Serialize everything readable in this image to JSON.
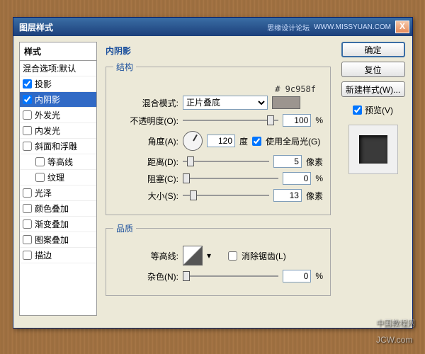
{
  "titlebar": {
    "title": "图层样式",
    "brand": "思缘设计论坛",
    "site": "WWW.MISSYUAN.COM",
    "close": "X"
  },
  "left": {
    "header": "样式",
    "blend_default": "混合选项:默认",
    "items": [
      {
        "label": "投影",
        "checked": true,
        "selected": false
      },
      {
        "label": "内阴影",
        "checked": true,
        "selected": true
      },
      {
        "label": "外发光",
        "checked": false,
        "selected": false
      },
      {
        "label": "内发光",
        "checked": false,
        "selected": false
      },
      {
        "label": "斜面和浮雕",
        "checked": false,
        "selected": false
      },
      {
        "label": "等高线",
        "checked": false,
        "selected": false,
        "indent": true
      },
      {
        "label": "纹理",
        "checked": false,
        "selected": false,
        "indent": true
      },
      {
        "label": "光泽",
        "checked": false,
        "selected": false
      },
      {
        "label": "颜色叠加",
        "checked": false,
        "selected": false
      },
      {
        "label": "渐变叠加",
        "checked": false,
        "selected": false
      },
      {
        "label": "图案叠加",
        "checked": false,
        "selected": false
      },
      {
        "label": "描边",
        "checked": false,
        "selected": false
      }
    ]
  },
  "mid": {
    "title": "内阴影",
    "structure": {
      "legend": "结构",
      "blend_label": "混合模式:",
      "blend_value": "正片叠底",
      "hex": "# 9c958f",
      "opacity_label": "不透明度(O):",
      "opacity_value": "100",
      "opacity_unit": "%",
      "angle_label": "角度(A):",
      "angle_value": "120",
      "angle_unit": "度",
      "global_light": "使用全局光(G)",
      "distance_label": "距离(D):",
      "distance_value": "5",
      "distance_unit": "像素",
      "choke_label": "阻塞(C):",
      "choke_value": "0",
      "choke_unit": "%",
      "size_label": "大小(S):",
      "size_value": "13",
      "size_unit": "像素"
    },
    "quality": {
      "legend": "品质",
      "contour_label": "等高线:",
      "antialias": "消除锯齿(L)",
      "noise_label": "杂色(N):",
      "noise_value": "0",
      "noise_unit": "%"
    }
  },
  "right": {
    "ok": "确定",
    "cancel": "复位",
    "newstyle": "新建样式(W)...",
    "preview_label": "预览(V)"
  },
  "watermark": {
    "main": "JCW.com",
    "sub": "中国教程网"
  }
}
